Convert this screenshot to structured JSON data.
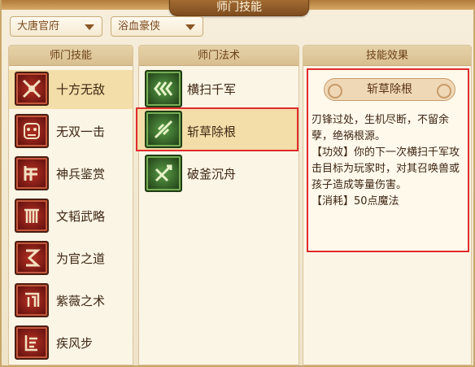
{
  "window": {
    "title": "师门技能"
  },
  "filters": {
    "sect": "大唐官府",
    "path": "浴血豪侠"
  },
  "skills_panel": {
    "header": "师门技能",
    "items": [
      {
        "label": "十方无敌",
        "icon": "crossed-blades-icon",
        "selected": true
      },
      {
        "label": "无双一击",
        "icon": "beast-mask-icon",
        "selected": false
      },
      {
        "label": "神兵鉴赏",
        "icon": "weapon-rack-icon",
        "selected": false
      },
      {
        "label": "文韬武略",
        "icon": "scroll-gate-icon",
        "selected": false
      },
      {
        "label": "为官之道",
        "icon": "seal-knot-icon",
        "selected": false
      },
      {
        "label": "紫薇之术",
        "icon": "rune-square-icon",
        "selected": false
      },
      {
        "label": "疾风步",
        "icon": "stairs-rune-icon",
        "selected": false
      }
    ]
  },
  "spells_panel": {
    "header": "师门法术",
    "items": [
      {
        "label": "横扫千军",
        "icon": "triple-arrow-icon",
        "selected": false
      },
      {
        "label": "斩草除根",
        "icon": "leaf-blade-icon",
        "selected": true
      },
      {
        "label": "破釜沉舟",
        "icon": "crossed-sword-icon",
        "selected": false
      }
    ]
  },
  "effect_panel": {
    "header": "技能效果",
    "title": "斩草除根",
    "description": "刃锋过处，生机尽断，不留余孽，绝祸根源。",
    "effect": "【功效】你的下一次横扫千军攻击目标为玩家时，对其召唤兽或孩子造成等量伤害。",
    "cost": "【消耗】50点魔法"
  },
  "colors": {
    "selected_row": "#f3dda8",
    "highlight_border": "#e02c2c",
    "header_bg": "#d8bf90"
  }
}
